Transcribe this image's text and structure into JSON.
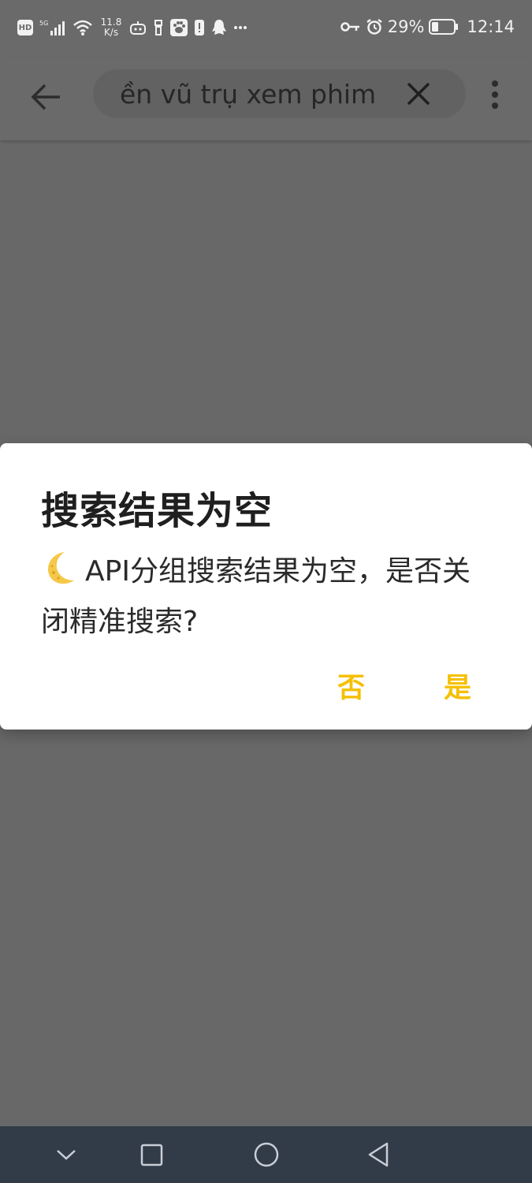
{
  "status_bar": {
    "net_speed_value": "11.8",
    "net_speed_unit": "K/s",
    "battery_percent": "29%",
    "clock": "12:14",
    "icons": [
      "hd-icon",
      "5g-signal-icon",
      "wifi-icon",
      "app-notification-icon",
      "usb-icon",
      "baidu-icon",
      "alert-icon",
      "qq-icon",
      "more-dots-icon",
      "vpn-key-icon",
      "alarm-icon",
      "battery-icon"
    ]
  },
  "toolbar": {
    "search_value": "ền vũ trụ xem phim",
    "icons": [
      "back-arrow-icon",
      "clear-icon",
      "more-vertical-icon"
    ]
  },
  "dialog": {
    "title": "搜索结果为空",
    "message": "API分组搜索结果为空，是否关闭精准搜索?",
    "message_icon": "crescent-moon-icon",
    "no_label": "否",
    "yes_label": "是",
    "button_color": "#f5c000"
  },
  "nav_bar": {
    "icons": [
      "chevron-down-icon",
      "recents-square-icon",
      "home-circle-icon",
      "back-triangle-icon"
    ]
  }
}
